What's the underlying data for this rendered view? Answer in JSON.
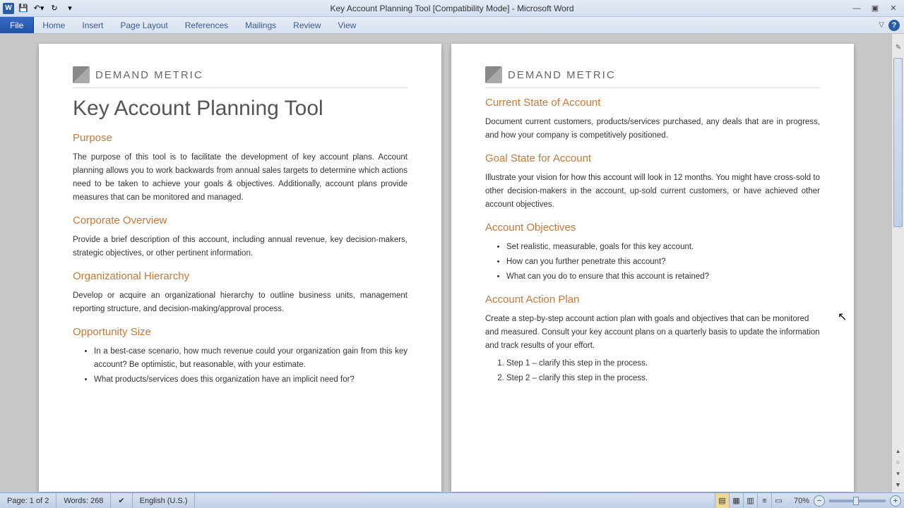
{
  "window": {
    "title": "Key Account Planning Tool [Compatibility Mode] - Microsoft Word"
  },
  "ribbon": {
    "file": "File",
    "tabs": [
      "Home",
      "Insert",
      "Page Layout",
      "References",
      "Mailings",
      "Review",
      "View"
    ]
  },
  "logo": {
    "name": "DEMAND METRIC"
  },
  "page1": {
    "title": "Key Account Planning Tool",
    "s1": {
      "h": "Purpose",
      "p": "The purpose of this tool is to facilitate the development of key account plans.  Account planning allows you to work backwards from annual sales targets to determine which actions need to be taken to achieve your goals & objectives.  Additionally, account plans provide measures that can be monitored and managed."
    },
    "s2": {
      "h": "Corporate Overview",
      "p": "Provide a brief description of this account, including annual revenue, key decision-makers, strategic objectives, or other pertinent information."
    },
    "s3": {
      "h": "Organizational Hierarchy",
      "p": "Develop or acquire an organizational hierarchy to outline business units, management reporting structure, and decision-making/approval process."
    },
    "s4": {
      "h": "Opportunity Size",
      "b1": "In a best-case scenario, how much revenue could your organization gain from this key account?  Be optimistic, but reasonable, with your estimate.",
      "b2": "What products/services does this organization have an implicit need for?"
    }
  },
  "page2": {
    "s1": {
      "h": "Current State of Account",
      "p": "Document current customers, products/services purchased, any deals that are in progress, and how your company is competitively positioned."
    },
    "s2": {
      "h": "Goal State for Account",
      "p": "Illustrate your vision for how this account will look in 12 months.  You might have cross-sold to other decision-makers in the account, up-sold current customers, or have achieved other account objectives."
    },
    "s3": {
      "h": "Account Objectives",
      "b1": "Set realistic, measurable, goals for this key account.",
      "b2": "How can you further penetrate this account?",
      "b3": "What can you do to ensure that this account is retained?"
    },
    "s4": {
      "h": "Account Action Plan",
      "p": "Create a step-by-step account action plan with goals and objectives that can be monitored and measured.  Consult your key account plans on a quarterly basis to update the information and track results of your effort.",
      "o1": "Step 1 – clarify this step in the process.",
      "o2": "Step 2 – clarify this step in the process."
    }
  },
  "status": {
    "page": "Page: 1 of 2",
    "words": "Words: 268",
    "lang": "English (U.S.)",
    "zoom": "70%"
  }
}
